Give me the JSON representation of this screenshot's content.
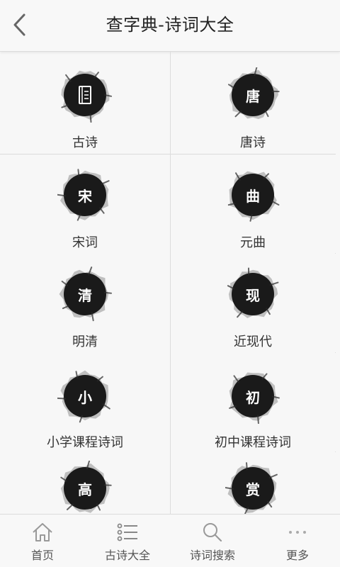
{
  "header": {
    "title": "查字典-诗词大全",
    "back_icon": "chevron-left-icon"
  },
  "categories": [
    {
      "label": "古诗",
      "glyph": "",
      "icon": "book-icon"
    },
    {
      "label": "唐诗",
      "glyph": "唐",
      "icon": "tang-ink-icon"
    },
    {
      "label": "宋词",
      "glyph": "宋",
      "icon": "song-ink-icon"
    },
    {
      "label": "元曲",
      "glyph": "曲",
      "icon": "qu-ink-icon"
    },
    {
      "label": "明清",
      "glyph": "清",
      "icon": "qing-ink-icon"
    },
    {
      "label": "近现代",
      "glyph": "现",
      "icon": "xian-ink-icon"
    },
    {
      "label": "小学课程诗词",
      "glyph": "小",
      "icon": "xiao-ink-icon"
    },
    {
      "label": "初中课程诗词",
      "glyph": "初",
      "icon": "chu-ink-icon"
    },
    {
      "label": "",
      "glyph": "高",
      "icon": "gao-ink-icon"
    },
    {
      "label": "",
      "glyph": "赏",
      "icon": "shang-ink-icon"
    }
  ],
  "tabbar": {
    "tabs": [
      {
        "label": "首页",
        "icon": "home-icon"
      },
      {
        "label": "古诗大全",
        "icon": "list-icon"
      },
      {
        "label": "诗词搜索",
        "icon": "search-icon"
      },
      {
        "label": "更多",
        "icon": "more-dots-icon"
      }
    ]
  },
  "colors": {
    "background": "#f7f7f7",
    "divider": "#dcdcdc",
    "ink": "#1a1a1a",
    "text": "#333333"
  }
}
